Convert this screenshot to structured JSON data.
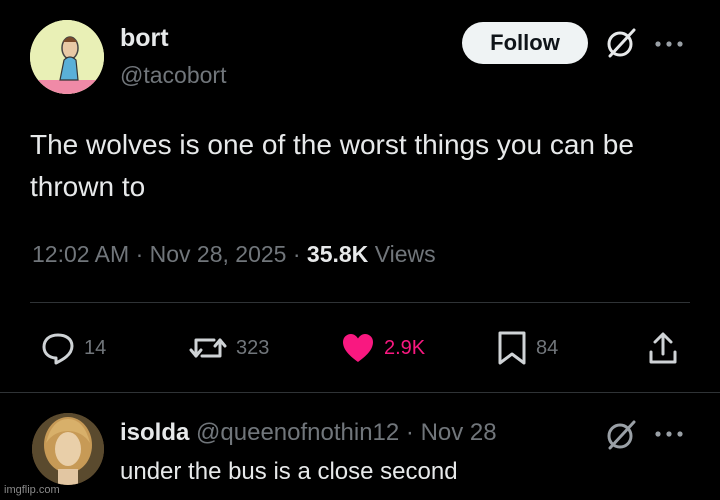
{
  "tweet": {
    "author": {
      "name": "bort",
      "handle": "@tacobort"
    },
    "follow_label": "Follow",
    "text": "The wolves is one of the worst things you can be thrown to",
    "time": "12:02 AM",
    "date": "Nov 28, 2025",
    "separator": "·",
    "views_count": "35.8K",
    "views_label": "Views"
  },
  "actions": {
    "replies": "14",
    "reposts": "323",
    "likes": "2.9K",
    "bookmarks": "84"
  },
  "reply": {
    "name": "isolda",
    "handle": "@queenofnothin12",
    "separator": "·",
    "date": "Nov 28",
    "text": "under the bus is a close second"
  },
  "watermark": "imgflip.com",
  "colors": {
    "background": "#000000",
    "text": "#e7e9ea",
    "muted": "#71767b",
    "like": "#f91880",
    "follow_bg": "#eff3f4",
    "divider": "#2f3336"
  },
  "icons": [
    "grok-icon",
    "more-icon",
    "reply-icon",
    "repost-icon",
    "heart-icon",
    "bookmark-icon",
    "share-icon"
  ]
}
